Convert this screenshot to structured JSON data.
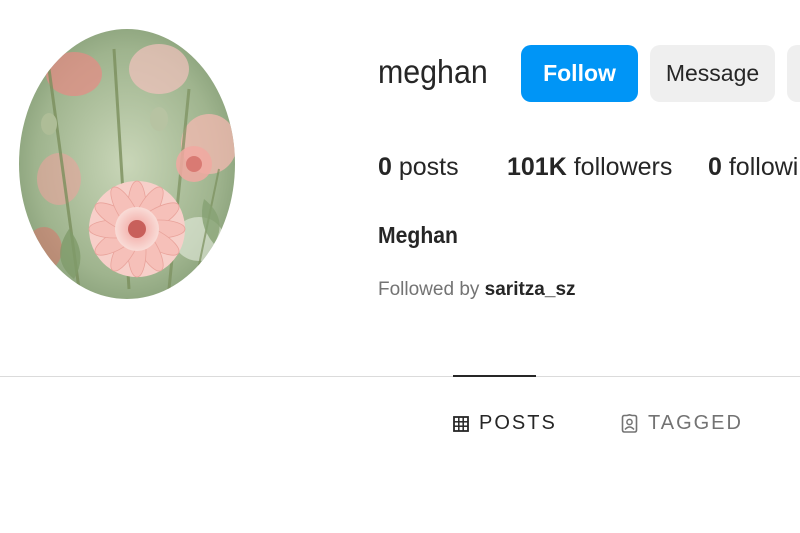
{
  "profile": {
    "username": "meghan",
    "full_name": "Meghan",
    "avatar_icon": "flower-avatar"
  },
  "actions": {
    "follow_label": "Follow",
    "message_label": "Message"
  },
  "stats": {
    "posts_count": "0",
    "posts_label": "posts",
    "followers_count": "101K",
    "followers_label": "followers",
    "following_count": "0",
    "following_label": "followin"
  },
  "followed_by": {
    "prefix": "Followed by",
    "user": "saritza_sz"
  },
  "tabs": [
    {
      "label": "POSTS",
      "icon": "grid-icon",
      "active": true
    },
    {
      "label": "TAGGED",
      "icon": "tagged-icon",
      "active": false
    }
  ],
  "colors": {
    "accent": "#0095f6",
    "button_secondary": "#efefef",
    "text_primary": "#262626",
    "text_secondary": "#737373",
    "divider": "#dbdbdb"
  }
}
